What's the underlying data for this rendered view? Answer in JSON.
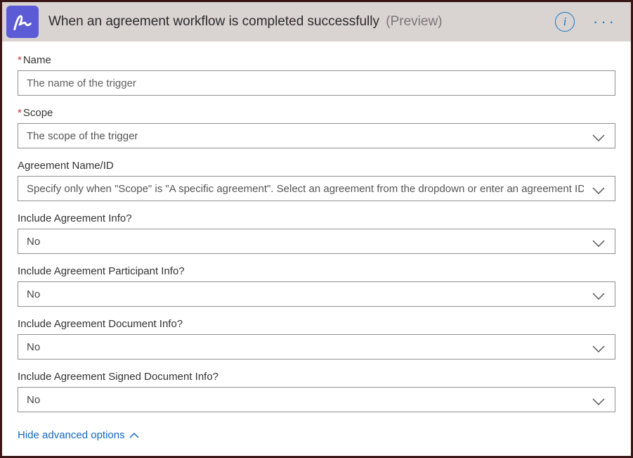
{
  "header": {
    "title": "When an agreement workflow is completed successfully",
    "suffix": "(Preview)"
  },
  "fields": {
    "name": {
      "label": "Name",
      "required": true,
      "placeholder": "The name of the trigger"
    },
    "scope": {
      "label": "Scope",
      "required": true,
      "placeholder": "The scope of the trigger"
    },
    "agreement": {
      "label": "Agreement Name/ID",
      "required": false,
      "placeholder": "Specify only when \"Scope\" is \"A specific agreement\". Select an agreement from the dropdown or enter an agreement ID."
    },
    "includeInfo": {
      "label": "Include Agreement Info?",
      "value": "No"
    },
    "includeParticipant": {
      "label": "Include Agreement Participant Info?",
      "value": "No"
    },
    "includeDocument": {
      "label": "Include Agreement Document Info?",
      "value": "No"
    },
    "includeSigned": {
      "label": "Include Agreement Signed Document Info?",
      "value": "No"
    }
  },
  "advanced_link": "Hide advanced options"
}
